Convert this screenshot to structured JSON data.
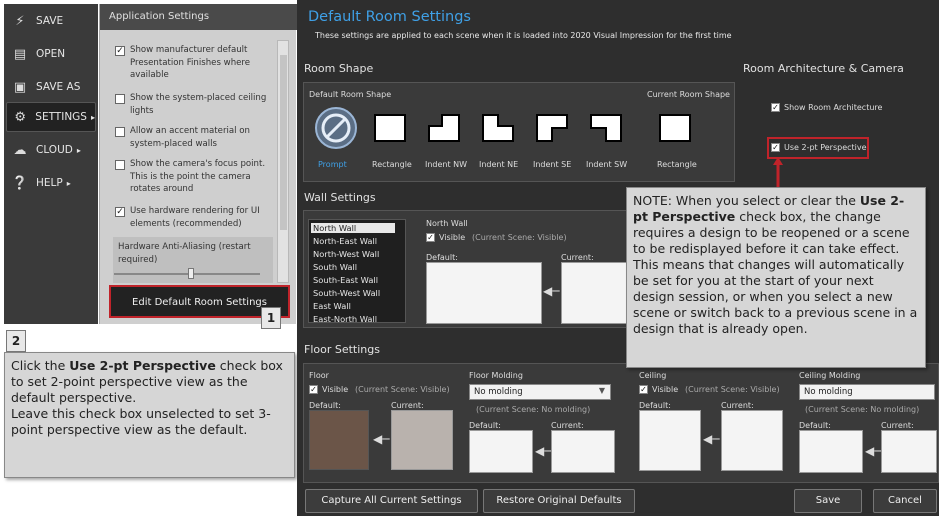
{
  "left_nav": {
    "items": [
      {
        "label": "SAVE",
        "icon": "lightning-icon"
      },
      {
        "label": "OPEN",
        "icon": "folder-icon"
      },
      {
        "label": "SAVE AS",
        "icon": "save-icon"
      },
      {
        "label": "SETTINGS",
        "icon": "gear-icon",
        "active": true
      },
      {
        "label": "CLOUD",
        "icon": "cloud-icon"
      },
      {
        "label": "HELP",
        "icon": "help-icon"
      }
    ]
  },
  "app_settings": {
    "title": "Application Settings",
    "options": [
      {
        "label": "Show manufacturer default Presentation Finishes where available",
        "checked": true
      },
      {
        "label": "Show the system-placed ceiling lights",
        "checked": false
      },
      {
        "label": "Allow an accent material on system-placed walls",
        "checked": false
      },
      {
        "label": "Show the camera's focus point. This is the point the camera rotates around",
        "checked": false
      },
      {
        "label": "Use hardware rendering for UI elements (recommended)",
        "checked": true
      }
    ],
    "anti_aliasing_label": "Hardware Anti-Aliasing (restart required)",
    "anti_aliasing_level": 0.5,
    "edit_button": "Edit Default Room Settings"
  },
  "callouts": {
    "badge1": "1",
    "badge2": "2",
    "step2_parts": [
      "Click the ",
      "Use 2-pt Perspective",
      " check box to set 2-point perspective view as the default perspective.",
      "Leave this check box unselected to set 3-point perspective view as the default."
    ],
    "note_parts": [
      "NOTE: When you select or clear the ",
      "Use 2-pt Perspective",
      " check box, the change requires a design to be reopened or a scene to be redisplayed before it can take effect.",
      "This means that changes will automatically be set for you at the start of your next design session, or when you select a new scene or switch back to a previous scene in a design that is already open."
    ]
  },
  "room_settings": {
    "title": "Default Room Settings",
    "subtitle": "These settings are applied to each scene when it is loaded into 2020 Visual Impression for the first time",
    "room_shape": {
      "section_title": "Room Shape",
      "default_label": "Default Room Shape",
      "current_label": "Current Room Shape",
      "shapes": [
        "Prompt",
        "Rectangle",
        "Indent NW",
        "Indent NE",
        "Indent SE",
        "Indent SW"
      ],
      "current_shape": "Rectangle"
    },
    "architecture": {
      "section_title": "Room Architecture & Camera",
      "show_architecture": "Show Room Architecture",
      "use_2pt": "Use 2-pt Perspective"
    },
    "wall_settings": {
      "section_title": "Wall Settings",
      "walls": [
        "North Wall",
        "North-East Wall",
        "North-West Wall",
        "South Wall",
        "South-East Wall",
        "South-West Wall",
        "East Wall",
        "East-North Wall"
      ],
      "selected_wall": "North Wall",
      "visible": "Visible",
      "current_scene": "(Current Scene: Visible)",
      "default": "Default:",
      "current": "Current:"
    },
    "floor_settings": {
      "section_title": "Floor Settings",
      "floor": "Floor",
      "visible": "Visible",
      "floor_current_scene": "(Current Scene: Visible)",
      "default": "Default:",
      "current": "Current:",
      "floor_molding": "Floor Molding",
      "no_molding": "No molding",
      "molding_current_scene": "(Current Scene: No molding)",
      "ceiling": "Ceiling",
      "ceiling_current_scene": "(Current Scene: Visible)",
      "ceiling_molding": "Ceiling Molding",
      "ceiling_no_molding": "No molding",
      "ceiling_molding_current_scene": "(Current Scene: No molding)"
    },
    "buttons": {
      "capture": "Capture All Current Settings",
      "restore": "Restore Original Defaults",
      "save": "Save",
      "cancel": "Cancel"
    }
  },
  "colors": {
    "accent_blue": "#3fa0e6",
    "highlight_red": "#c0232a"
  }
}
